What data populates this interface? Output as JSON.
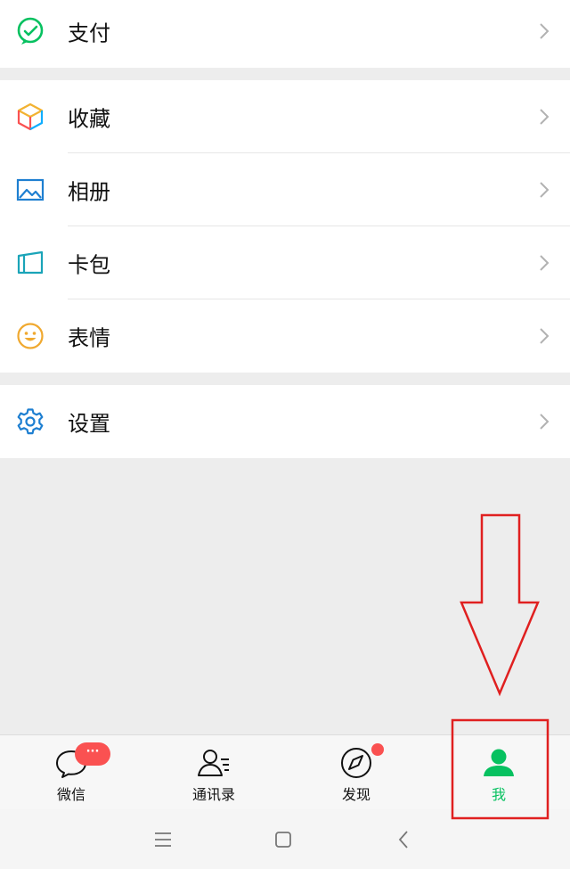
{
  "groups": {
    "pay": {
      "items": [
        {
          "label": "支付",
          "icon": "wechat-pay-icon"
        }
      ]
    },
    "main": {
      "items": [
        {
          "label": "收藏",
          "icon": "favorites-cube-icon"
        },
        {
          "label": "相册",
          "icon": "album-image-icon"
        },
        {
          "label": "卡包",
          "icon": "card-wallet-icon"
        },
        {
          "label": "表情",
          "icon": "smiley-icon"
        }
      ]
    },
    "settings": {
      "items": [
        {
          "label": "设置",
          "icon": "gear-icon"
        }
      ]
    }
  },
  "tabbar": {
    "tabs": [
      {
        "label": "微信",
        "icon": "chat-bubble-icon",
        "badge": "···"
      },
      {
        "label": "通讯录",
        "icon": "contacts-icon"
      },
      {
        "label": "发现",
        "icon": "compass-icon",
        "dot": true
      },
      {
        "label": "我",
        "icon": "person-icon",
        "active": true
      }
    ]
  },
  "system_nav": {
    "buttons": [
      "menu-icon",
      "home-icon",
      "back-icon"
    ]
  },
  "colors": {
    "accent": "#07c160",
    "badge": "#fa5151",
    "annotation": "#e02020",
    "background": "#ededed"
  }
}
